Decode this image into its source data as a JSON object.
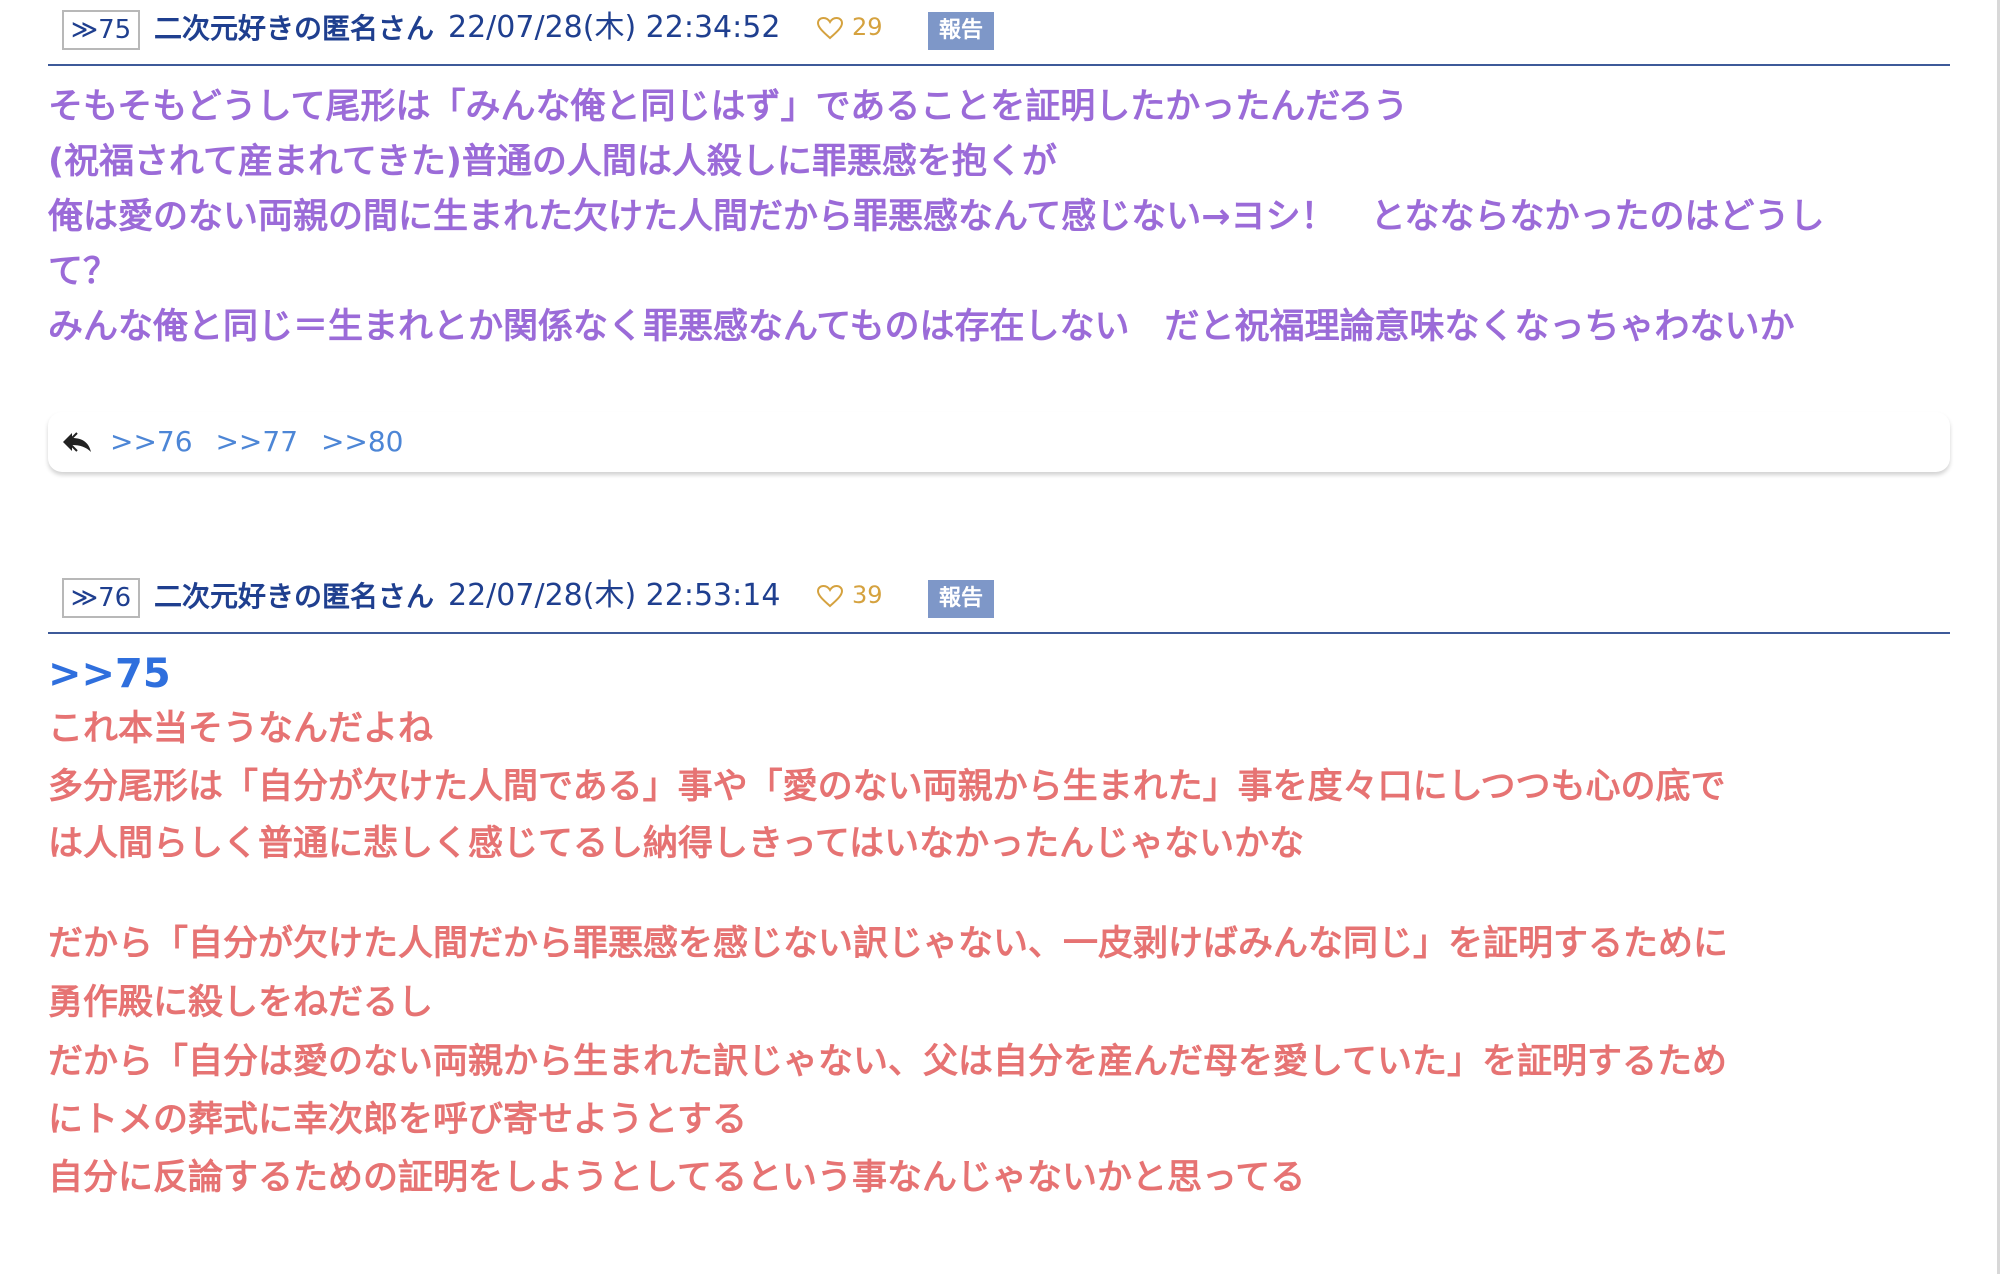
{
  "posts": [
    {
      "number": "≫75",
      "name": "二次元好きの匿名さん",
      "date": "22/07/28(木) 22:34:52",
      "likes": "29",
      "report_label": "報告",
      "lines": [
        "そもそもどうして尾形は「みんな俺と同じはず」であることを証明したかったんだろう",
        "(祝福されて産まれてきた)普通の人間は人殺しに罪悪感を抱くが",
        "俺は愛のない両親の間に生まれた欠けた人間だから罪悪感なんて感じない→ヨシ！　となならなかったのはどうし",
        "て？",
        "みんな俺と同じ＝生まれとか関係なく罪悪感なんてものは存在しない　だと祝福理論意味なくなっちゃわないか"
      ],
      "replies": [
        ">>76",
        ">>77",
        ">>80"
      ]
    },
    {
      "number": "≫76",
      "name": "二次元好きの匿名さん",
      "date": "22/07/28(木) 22:53:14",
      "likes": "39",
      "report_label": "報告",
      "anchor": ">>75",
      "lines_a": [
        "これ本当そうなんだよね",
        "多分尾形は「自分が欠けた人間である」事や「愛のない両親から生まれた」事を度々口にしつつも心の底で",
        "は人間らしく普通に悲しく感じてるし納得しきってはいなかったんじゃないかな"
      ],
      "lines_b": [
        "だから「自分が欠けた人間だから罪悪感を感じない訳じゃない、一皮剥けばみんな同じ」を証明するために",
        "勇作殿に殺しをねだるし",
        "だから「自分は愛のない両親から生まれた訳じゃない、父は自分を産んだ母を愛していた」を証明するため",
        "にトメの葬式に幸次郎を呼び寄せようとする",
        "自分に反論するための証明をしようとしてるという事なんじゃないかと思ってる"
      ]
    }
  ],
  "colors": {
    "header_blue": "#1f3f8f",
    "purple_text": "#9b6bd8",
    "red_text": "#e67373",
    "anchor_blue": "#2f6fdd",
    "like_gold": "#d5a23f",
    "report_bg": "#7e97c8"
  },
  "icons": {
    "like": "heart-outline-icon",
    "reply": "reply-arrow-icon"
  }
}
